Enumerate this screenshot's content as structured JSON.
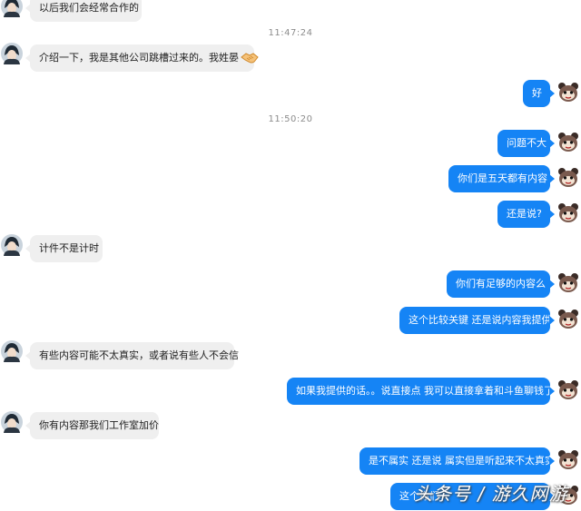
{
  "timestamps": [
    "11:47:24",
    "11:50:20"
  ],
  "messages": [
    {
      "side": "in",
      "text": "以后我们会经常合作的"
    },
    {
      "side": "in",
      "text": "介绍一下，我是其他公司跳槽过来的。我姓晏",
      "icon": "handshake-icon"
    },
    {
      "side": "out",
      "text": "好"
    },
    {
      "side": "out",
      "text": "问题不大"
    },
    {
      "side": "out",
      "text": "你们是五天都有内容"
    },
    {
      "side": "out",
      "text": "还是说?"
    },
    {
      "side": "in",
      "text": "计件不是计时"
    },
    {
      "side": "out",
      "text": "你们有足够的内容么"
    },
    {
      "side": "out",
      "text": "这个比较关键 还是说内容我提供"
    },
    {
      "side": "in",
      "text": "有些内容可能不太真实，或者说有些人不会信"
    },
    {
      "side": "out",
      "text": "如果我提供的话。。说直接点 我可以直接拿着和斗鱼聊钱了"
    },
    {
      "side": "in",
      "text": "你有内容那我们工作室加价"
    },
    {
      "side": "out",
      "text": "是不属实 还是说 属实但是听起来不太真实"
    },
    {
      "side": "out",
      "text": "这个你们"
    }
  ],
  "watermark": "头条号 / 游久网游",
  "colors": {
    "outgoing_bubble": "#1584f5",
    "incoming_bubble": "#efefef",
    "timestamp": "#8c8c8c"
  }
}
